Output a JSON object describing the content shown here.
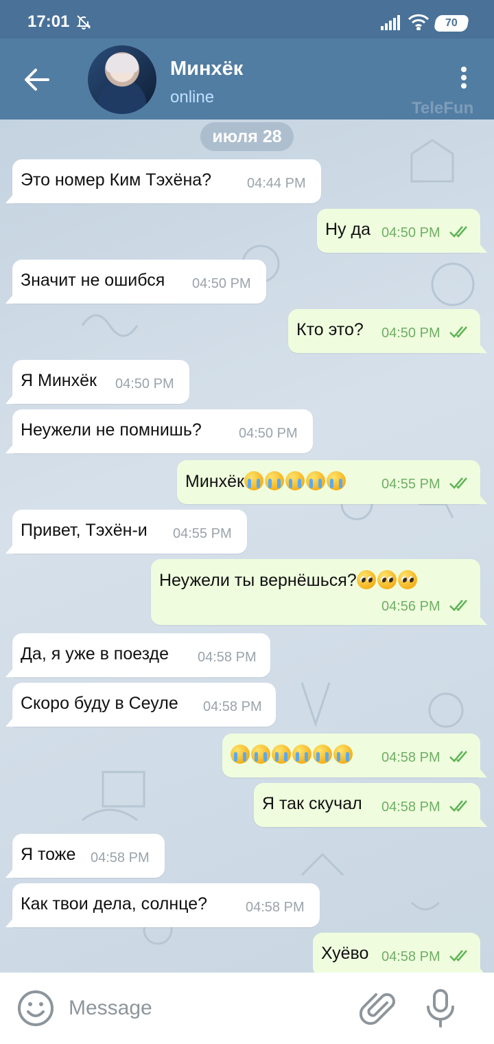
{
  "status_bar": {
    "time": "17:01",
    "battery": "70"
  },
  "header": {
    "contact_name": "Минхёк",
    "contact_status": "online",
    "watermark": "TeleFun"
  },
  "chat": {
    "date_chip": "июля 28",
    "messages": [
      {
        "direction": "in",
        "text": "Это номер Ким Тэхёна?",
        "time": "04:44 PM"
      },
      {
        "direction": "out",
        "text": "Ну да",
        "time": "04:50 PM",
        "read": true
      },
      {
        "direction": "in",
        "text": "Значит не ошибся",
        "time": "04:50 PM"
      },
      {
        "direction": "out",
        "text": "Кто это?",
        "time": "04:50 PM",
        "read": true
      },
      {
        "direction": "in",
        "text": "Я Минхёк",
        "time": "04:50 PM"
      },
      {
        "direction": "in",
        "text": "Неужели не помнишь?",
        "time": "04:50 PM"
      },
      {
        "direction": "out",
        "text": "Минхёк",
        "emoji": [
          "loudly-crying-face",
          "loudly-crying-face",
          "loudly-crying-face",
          "loudly-crying-face",
          "loudly-crying-face"
        ],
        "time": "04:55 PM",
        "read": true
      },
      {
        "direction": "in",
        "text": "Привет, Тэхён-и",
        "time": "04:55 PM"
      },
      {
        "direction": "out",
        "text": "Неужели ты вернёшься?",
        "emoji": [
          "pleading-face",
          "pleading-face",
          "pleading-face"
        ],
        "time": "04:56 PM",
        "read": true
      },
      {
        "direction": "in",
        "text": "Да, я уже в поезде",
        "time": "04:58 PM"
      },
      {
        "direction": "in",
        "text": "Скоро буду в Сеуле",
        "time": "04:58 PM"
      },
      {
        "direction": "out",
        "text": "",
        "emoji": [
          "loudly-crying-face",
          "loudly-crying-face",
          "loudly-crying-face",
          "loudly-crying-face",
          "loudly-crying-face",
          "loudly-crying-face"
        ],
        "time": "04:58 PM",
        "read": true
      },
      {
        "direction": "out",
        "text": "Я так скучал",
        "time": "04:58 PM",
        "read": true
      },
      {
        "direction": "in",
        "text": "Я тоже",
        "time": "04:58 PM"
      },
      {
        "direction": "in",
        "text": "Как твои дела, солнце?",
        "time": "04:58 PM"
      },
      {
        "direction": "out",
        "text": "Хуёво",
        "time": "04:58 PM",
        "read": true
      }
    ]
  },
  "input": {
    "placeholder": "Message"
  },
  "colors": {
    "header": "#527da3",
    "status_bar": "#4a7198",
    "outgoing_bubble": "#effdde",
    "incoming_bubble": "#ffffff",
    "read_check": "#5fb355"
  }
}
